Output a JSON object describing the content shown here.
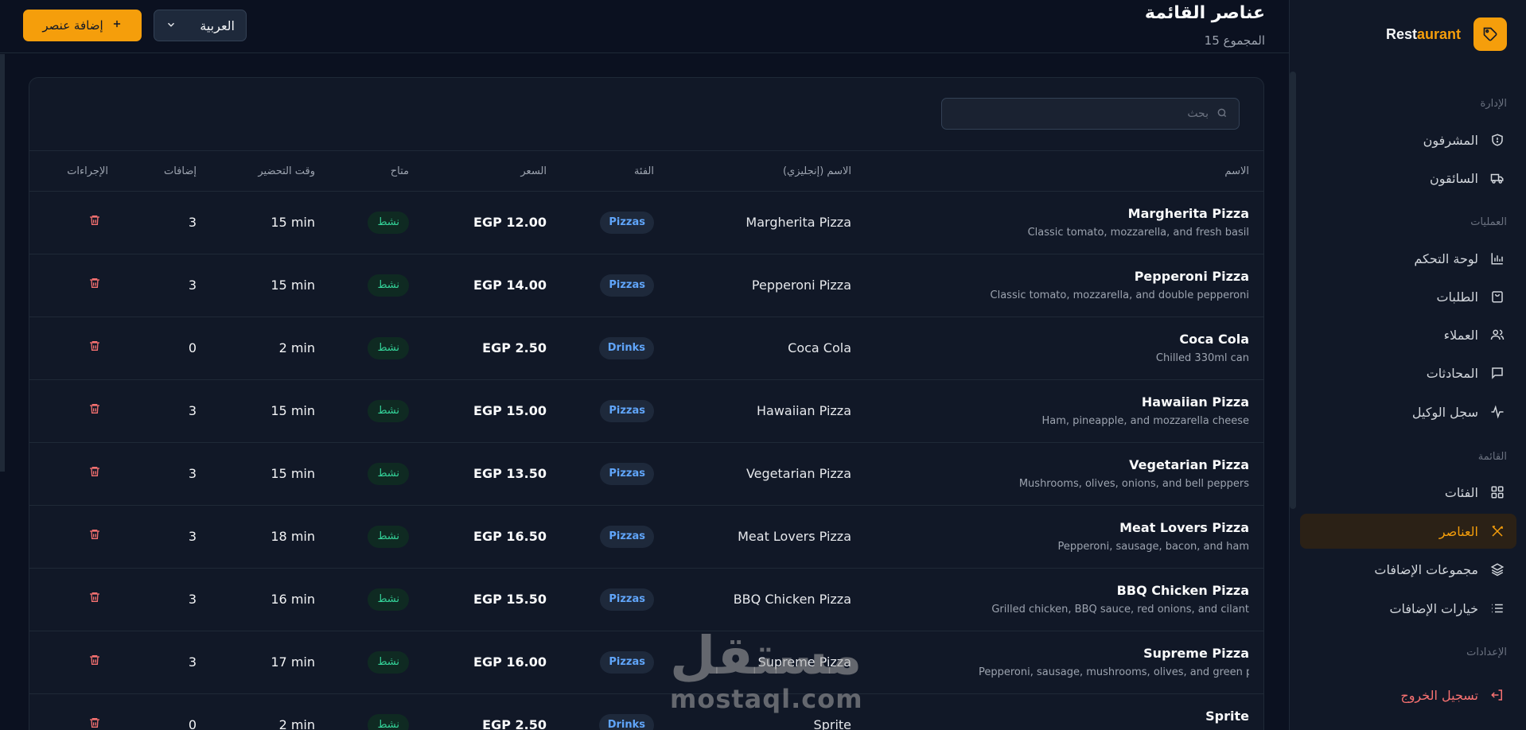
{
  "colors": {
    "accent": "#f59e0b",
    "background": "#0b1120",
    "panel": "#111827",
    "active_status": "#34d399",
    "category": "#60a5fa",
    "danger": "#f87171"
  },
  "brand": {
    "name_main": "Rest",
    "name_accent": "aurant",
    "icon": "tag-icon"
  },
  "sidebar": {
    "sections": {
      "management": "الإدارة",
      "operations": "العمليات",
      "menu": "القائمة",
      "settings": "الإعدادات"
    },
    "items": {
      "admins": {
        "label": "المشرفون",
        "icon": "shield-icon"
      },
      "drivers": {
        "label": "السائقون",
        "icon": "truck-icon"
      },
      "dashboard": {
        "label": "لوحة التحكم",
        "icon": "bar-chart-icon"
      },
      "orders": {
        "label": "الطلبات",
        "icon": "shopping-bag-icon"
      },
      "customers": {
        "label": "العملاء",
        "icon": "users-icon"
      },
      "conversations": {
        "label": "المحادثات",
        "icon": "message-icon"
      },
      "agent_log": {
        "label": "سجل الوكيل",
        "icon": "activity-icon"
      },
      "categories": {
        "label": "الفئات",
        "icon": "grid-icon"
      },
      "items": {
        "label": "العناصر",
        "icon": "utensils-icon",
        "active": true
      },
      "addon_groups": {
        "label": "مجموعات الإضافات",
        "icon": "layers-icon"
      },
      "addon_options": {
        "label": "خيارات الإضافات",
        "icon": "list-icon"
      }
    },
    "logout": {
      "label": "تسجيل الخروج",
      "icon": "logout-icon"
    }
  },
  "header": {
    "title": "عناصر القائمة",
    "subtitle": "15 المجموع",
    "add_button": "إضافة عنصر",
    "language": "العربية"
  },
  "search": {
    "placeholder": "بحث"
  },
  "table": {
    "columns": {
      "name": "الاسم",
      "name_en": "الاسم (إنجليزي)",
      "category": "الفئة",
      "price": "السعر",
      "available": "متاح",
      "prep_time": "وقت التحضير",
      "addons": "إضافات",
      "actions": "الإجراءات"
    },
    "rows": [
      {
        "name": "Margherita Pizza",
        "desc": "Classic tomato, mozzarella, and fresh basil",
        "name_en": "Margherita Pizza",
        "category": "Pizzas",
        "price": "EGP 12.00",
        "status": "نشط",
        "prep": "15 min",
        "addons": "3"
      },
      {
        "name": "Pepperoni Pizza",
        "desc": "Classic tomato, mozzarella, and double pepperoni",
        "name_en": "Pepperoni Pizza",
        "category": "Pizzas",
        "price": "EGP 14.00",
        "status": "نشط",
        "prep": "15 min",
        "addons": "3"
      },
      {
        "name": "Coca Cola",
        "desc": "Chilled 330ml can",
        "name_en": "Coca Cola",
        "category": "Drinks",
        "price": "EGP 2.50",
        "status": "نشط",
        "prep": "2 min",
        "addons": "0"
      },
      {
        "name": "Hawaiian Pizza",
        "desc": "Ham, pineapple, and mozzarella cheese",
        "name_en": "Hawaiian Pizza",
        "category": "Pizzas",
        "price": "EGP 15.00",
        "status": "نشط",
        "prep": "15 min",
        "addons": "3"
      },
      {
        "name": "Vegetarian Pizza",
        "desc": "Mushrooms, olives, onions, and bell peppers",
        "name_en": "Vegetarian Pizza",
        "category": "Pizzas",
        "price": "EGP 13.50",
        "status": "نشط",
        "prep": "15 min",
        "addons": "3"
      },
      {
        "name": "Meat Lovers Pizza",
        "desc": "Pepperoni, sausage, bacon, and ham",
        "name_en": "Meat Lovers Pizza",
        "category": "Pizzas",
        "price": "EGP 16.50",
        "status": "نشط",
        "prep": "18 min",
        "addons": "3"
      },
      {
        "name": "BBQ Chicken Pizza",
        "desc": "Grilled chicken, BBQ sauce, red onions, and cilant",
        "name_en": "BBQ Chicken Pizza",
        "category": "Pizzas",
        "price": "EGP 15.50",
        "status": "نشط",
        "prep": "16 min",
        "addons": "3"
      },
      {
        "name": "Supreme Pizza",
        "desc": "Pepperoni, sausage, mushrooms, olives, and green p",
        "name_en": "Supreme Pizza",
        "category": "Pizzas",
        "price": "EGP 16.00",
        "status": "نشط",
        "prep": "17 min",
        "addons": "3"
      },
      {
        "name": "Sprite",
        "desc": "",
        "name_en": "Sprite",
        "category": "Drinks",
        "price": "EGP 2.50",
        "status": "نشط",
        "prep": "2 min",
        "addons": "0"
      }
    ]
  },
  "watermark": {
    "arabic": "مستقل",
    "latin": "mostaql.com"
  }
}
